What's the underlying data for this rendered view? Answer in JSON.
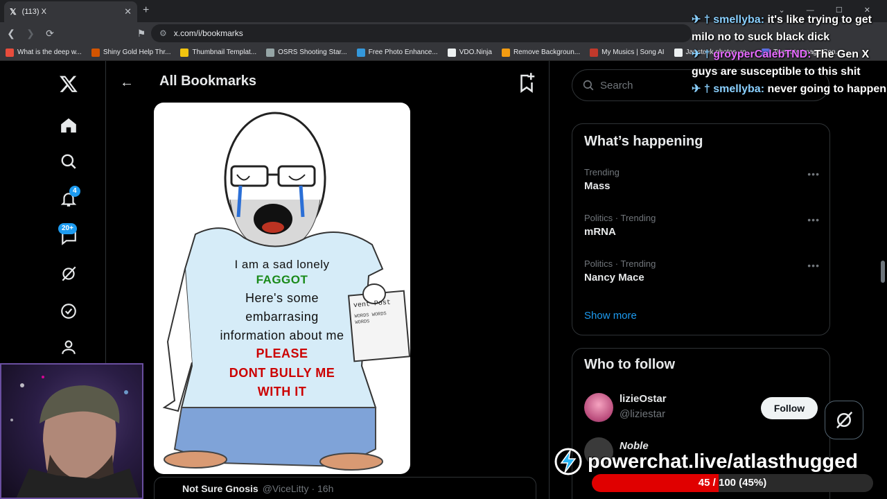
{
  "browser": {
    "tab_title": "(113) X",
    "tab_close": "✕",
    "new_tab": "+",
    "url": "x.com/i/bookmarks",
    "bookmarks": [
      {
        "label": "What is the deep w...",
        "color": "#e74c3c"
      },
      {
        "label": "Shiny Gold Help Thr...",
        "color": "#d35400"
      },
      {
        "label": "Thumbnail Templat...",
        "color": "#f1c40f"
      },
      {
        "label": "OSRS Shooting Star...",
        "color": "#95a5a6"
      },
      {
        "label": "Free Photo Enhance...",
        "color": "#3498db"
      },
      {
        "label": "VDO.Ninja",
        "color": "#ecf0f1"
      },
      {
        "label": "Remove Backgroun...",
        "color": "#f39c12"
      },
      {
        "label": "My Musics | Song AI",
        "color": "#c0392b"
      },
      {
        "label": "Jar stock photos, ro...",
        "color": "#ecf0f1"
      },
      {
        "label": "Tweet to Image Con...",
        "color": "#5b6ee1"
      }
    ]
  },
  "sidebar": {
    "notification_count": "4",
    "message_count": "20+"
  },
  "header": {
    "title": "All Bookmarks"
  },
  "meme": {
    "line1": "I am a sad lonely",
    "line2": "FAGGOT",
    "line3": "Here's  some",
    "line4": "embarrasing",
    "line5": "information about me",
    "line6": "PLEASE",
    "line7": "DONT BULLY ME",
    "line8": "WITH IT",
    "paper_label": "vent Post",
    "paper_words": "WORDS WORDS WORDS"
  },
  "tweet": {
    "author": "Not Sure Gnosis",
    "handle": "@ViceLitty · 16h"
  },
  "right": {
    "search_placeholder": "Search",
    "happening_title": "What’s happening",
    "trends": [
      {
        "context": "Trending",
        "name": "Mass"
      },
      {
        "context": "Politics · Trending",
        "name": "mRNA"
      },
      {
        "context": "Politics · Trending",
        "name": "Nancy Mace"
      }
    ],
    "show_more": "Show more",
    "follow_title": "Who to follow",
    "suggestions": [
      {
        "name": "lizieOstar",
        "handle": "@liziestar",
        "button": "Follow"
      },
      {
        "name": "Noble",
        "handle": ""
      }
    ]
  },
  "chat": [
    {
      "user": "smellyba:",
      "text": "it's like trying to get milo no to suck black dick",
      "color": "#8ad0ff"
    },
    {
      "user": "groyperCalebTND:",
      "text": "The Gen X guys are susceptible to this shit",
      "color": "#e66bff"
    },
    {
      "user": "smellyba:",
      "text": "never going to happen",
      "color": "#8ad0ff"
    }
  ],
  "overlay": {
    "powerchat": "powerchat.live/atlasthugged",
    "progress_text": "45 / 100 (45%)",
    "progress_fraction": 0.45
  }
}
